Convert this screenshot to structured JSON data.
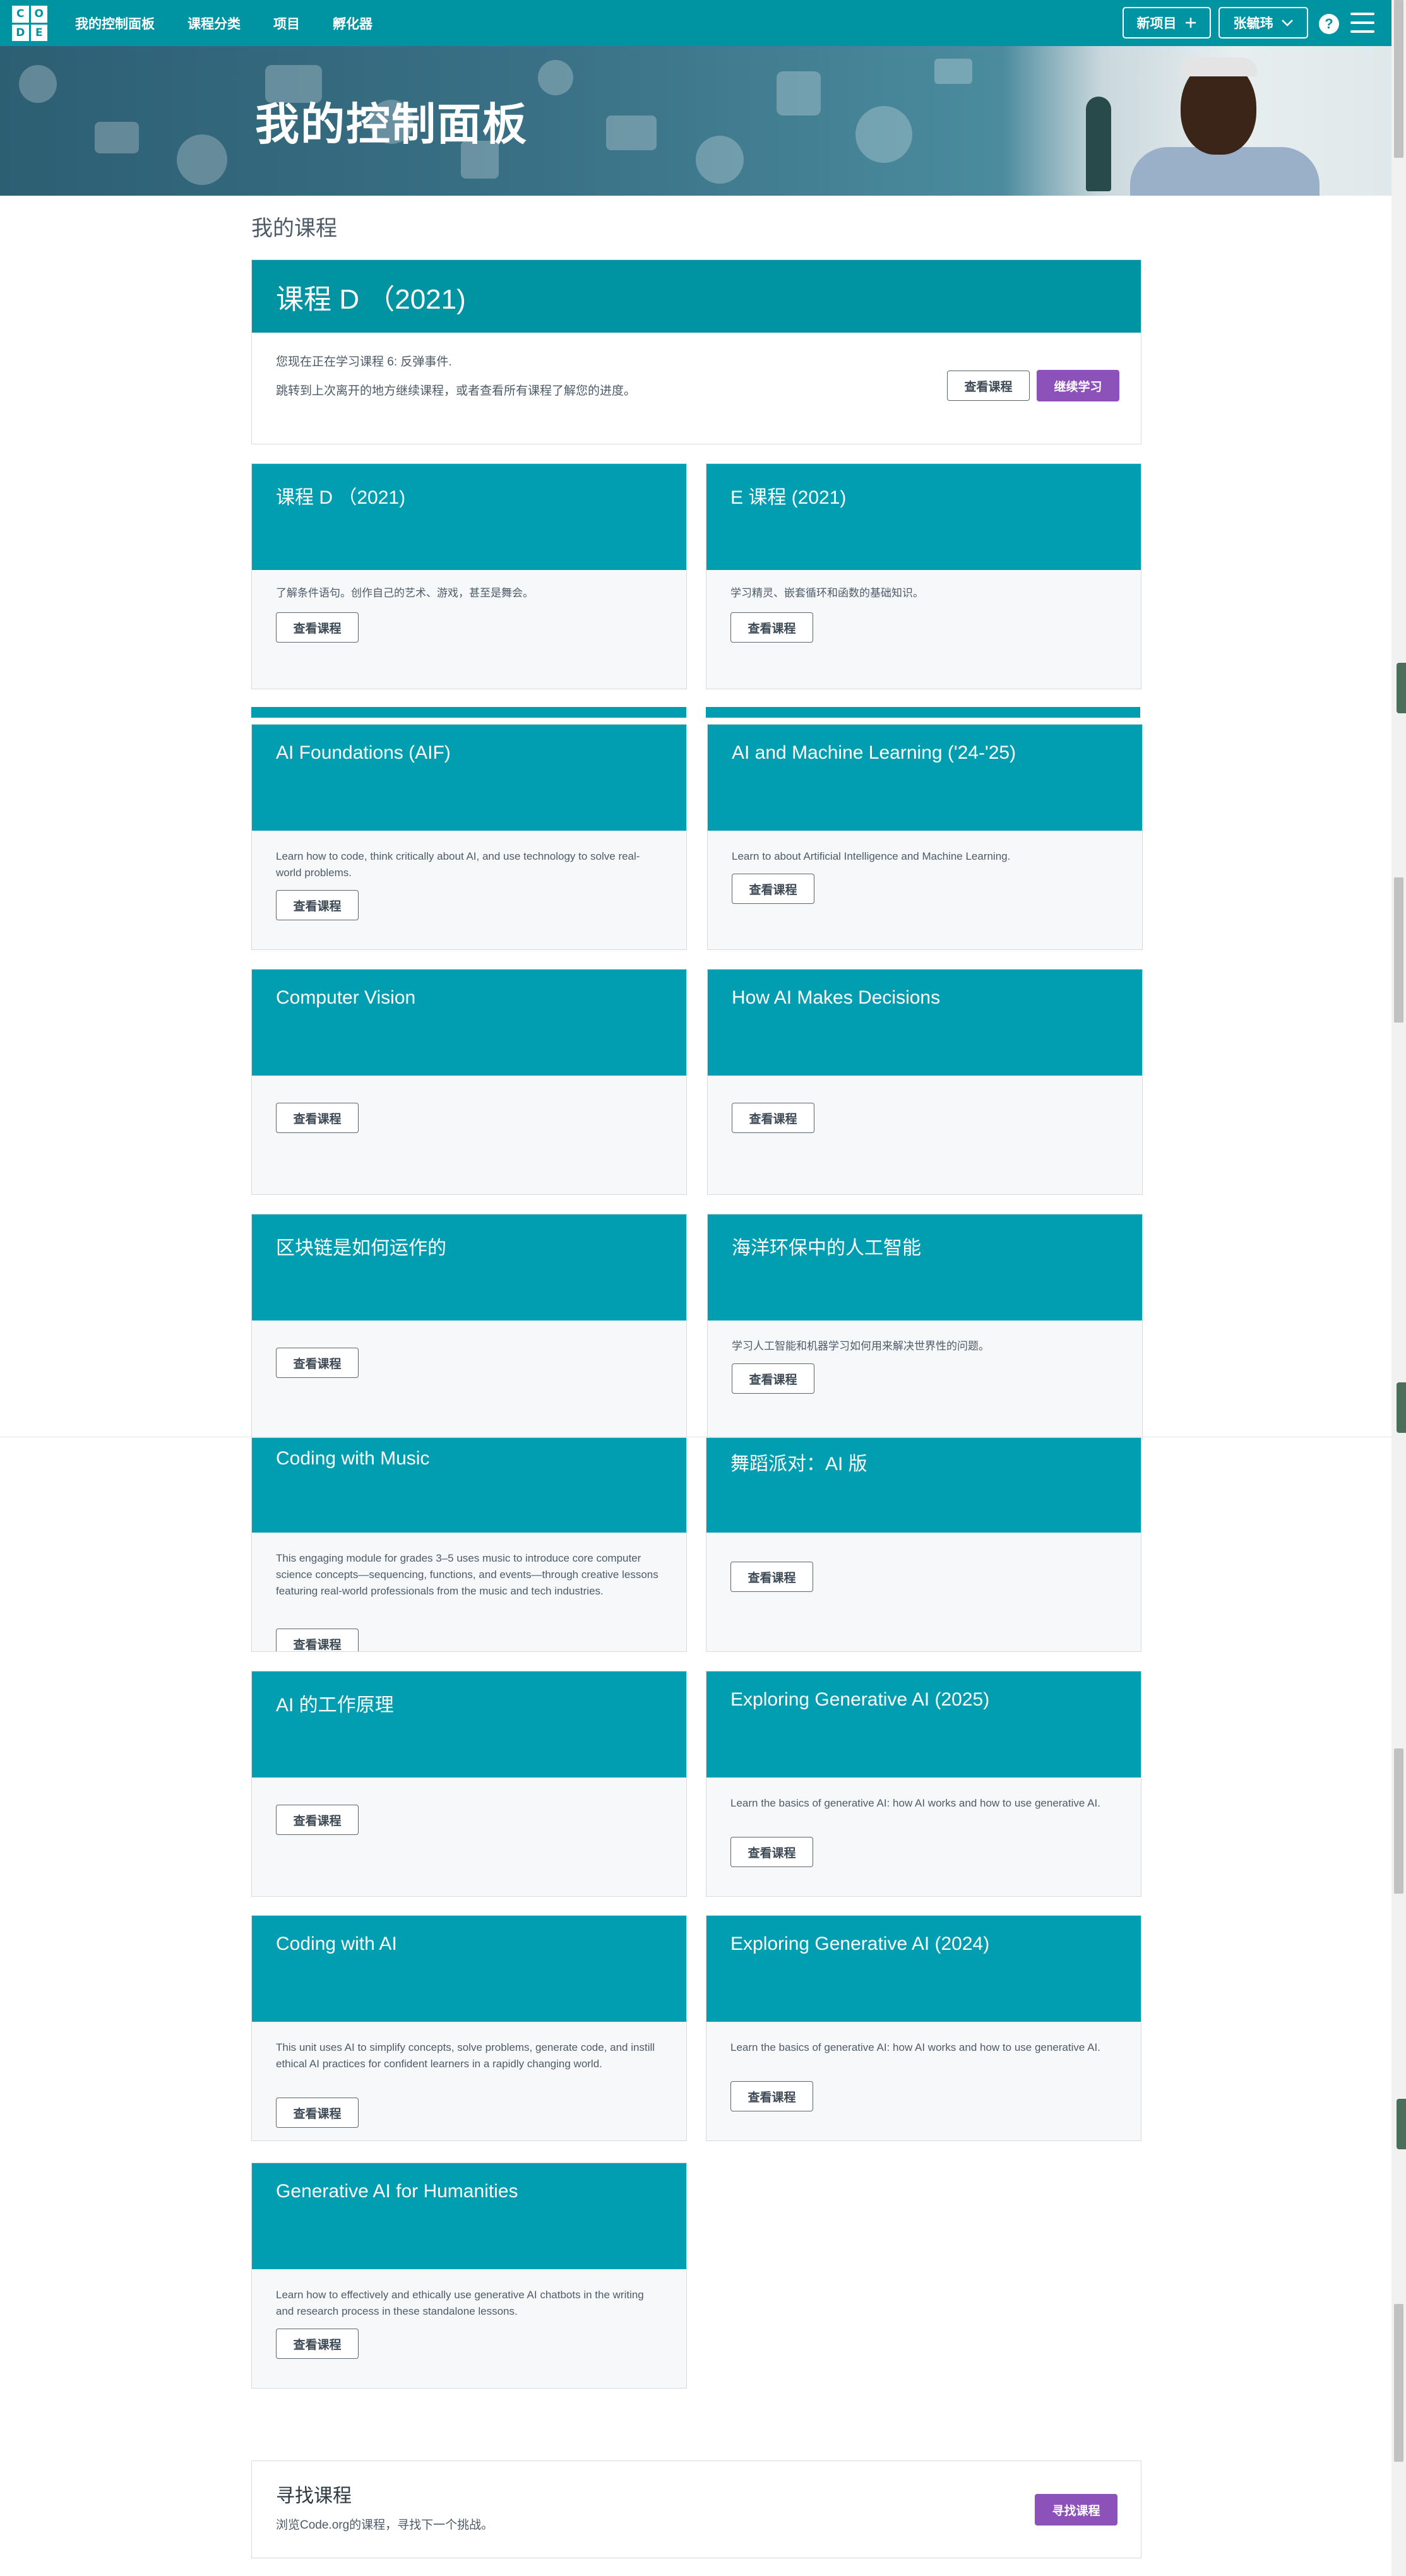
{
  "header": {
    "logo_letters": [
      "C",
      "O",
      "D",
      "E"
    ],
    "nav": [
      "我的控制面板",
      "课程分类",
      "项目",
      "孵化器"
    ],
    "new_project": "新项目",
    "new_project_icon": "plus-icon",
    "user_name": "张毓玮",
    "user_menu_icon": "chevron-down-icon",
    "help_label": "?",
    "menu_icon": "hamburger-menu-icon",
    "colors": {
      "bar": "#0094a3",
      "accent": "#8c52ba"
    }
  },
  "banner": {
    "title": "我的控制面板"
  },
  "my_courses": {
    "title": "我的课程",
    "current": {
      "title": "课程 D （2021)",
      "line1": "您现在正在学习课程 6: 反弹事件.",
      "line2": "跳转到上次离开的地方继续课程，或者查看所有课程了解您的进度。",
      "view_label": "查看课程",
      "continue_label": "继续学习"
    },
    "cards": [
      {
        "title": "课程 D （2021)",
        "desc": "了解条件语句。创作自己的艺术、游戏，甚至是舞会。",
        "button": "查看课程"
      },
      {
        "title": "E 课程 (2021)",
        "desc": "学习精灵、嵌套循环和函数的基础知识。",
        "button": "查看课程"
      },
      {
        "title": "AI Foundations (AIF)",
        "desc": "Learn how to code, think critically about AI, and use technology to solve real-world problems.",
        "button": "查看课程"
      },
      {
        "title": "AI and Machine Learning ('24-'25)",
        "desc": "Learn to about Artificial Intelligence and Machine Learning.",
        "button": "查看课程"
      },
      {
        "title": "Computer Vision",
        "desc": "",
        "button": "查看课程"
      },
      {
        "title": "How AI Makes Decisions",
        "desc": "",
        "button": "查看课程"
      },
      {
        "title": "区块链是如何运作的",
        "desc": "",
        "button": "查看课程"
      },
      {
        "title": "海洋环保中的人工智能",
        "desc": "学习人工智能和机器学习如何用来解决世界性的问题。",
        "button": "查看课程"
      },
      {
        "title": "Coding with Music",
        "desc": "This engaging module for grades 3–5 uses music to introduce core computer science concepts—sequencing, functions, and events—through creative lessons featuring real-world professionals from the music and tech industries.",
        "button": "查看课程"
      },
      {
        "title": "舞蹈派对：AI 版",
        "desc": "",
        "button": "查看课程"
      },
      {
        "title": "AI 的工作原理",
        "desc": "",
        "button": "查看课程"
      },
      {
        "title": "Exploring Generative AI (2025)",
        "desc": "Learn the basics of generative AI: how AI works and how to use generative AI.",
        "button": "查看课程"
      },
      {
        "title": "Coding with AI",
        "desc": "This unit uses AI to simplify concepts, solve problems, generate code, and instill ethical AI practices for confident learners in a rapidly changing world.",
        "button": "查看课程"
      },
      {
        "title": "Exploring Generative AI (2024)",
        "desc": "Learn the basics of generative AI: how AI works and how to use generative AI.",
        "button": "查看课程"
      },
      {
        "title": "Generative AI for Humanities",
        "desc": "Learn how to effectively and ethically use generative AI chatbots in the writing and research process in these standalone lessons.",
        "button": "查看课程"
      }
    ]
  },
  "find_course": {
    "title": "寻找课程",
    "subtitle": "浏览Code.org的课程，寻找下一个挑战。",
    "button": "寻找课程"
  }
}
